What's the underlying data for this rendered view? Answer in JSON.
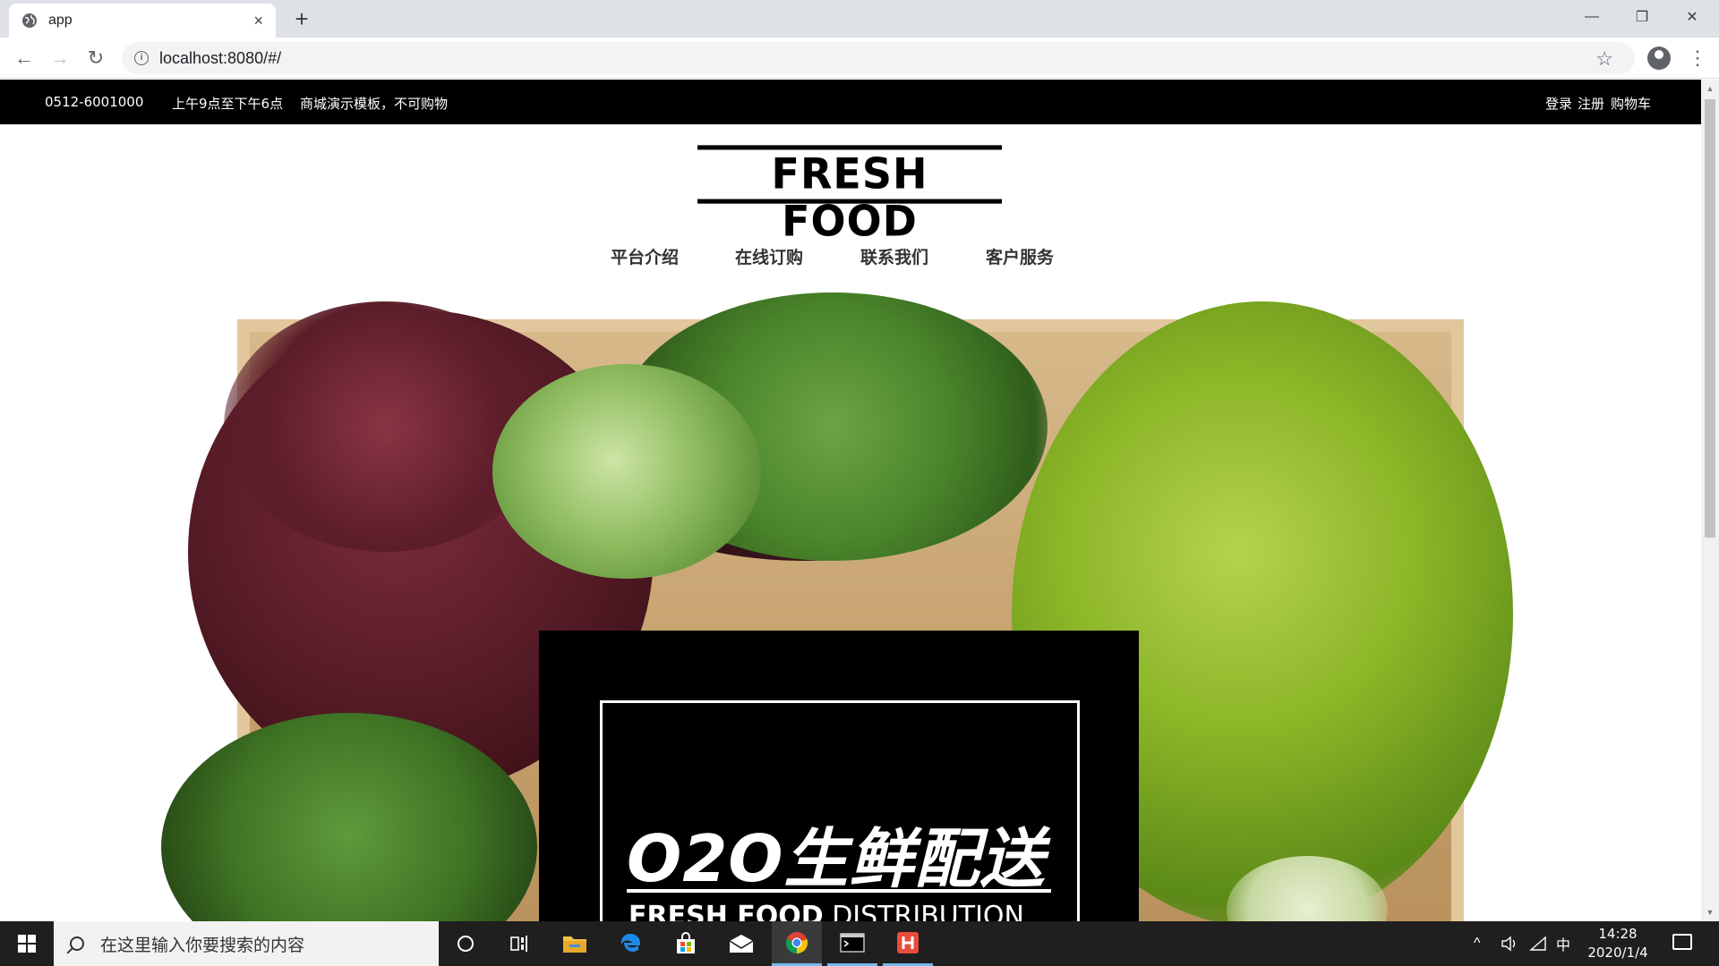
{
  "browser": {
    "tab_title": "app",
    "tab_close": "×",
    "new_tab": "+",
    "url": "localhost:8080/#/",
    "info_glyph": "i",
    "minimize": "—",
    "restore": "❐",
    "close": "✕",
    "back": "←",
    "forward": "→",
    "reload": "↻",
    "star": "☆",
    "menu": "⋮"
  },
  "topbar": {
    "phone": "0512-6001000",
    "hours": "上午9点至下午6点",
    "notice": "商城演示模板，不可购物",
    "login": "登录",
    "register": "注册",
    "cart": "购物车"
  },
  "logo": {
    "text": "FRESH FOOD"
  },
  "nav": {
    "items": [
      "平台介绍",
      "在线订购",
      "联系我们",
      "客户服务"
    ]
  },
  "hero": {
    "headline": "O2O生鲜配送",
    "subline_bold": "FRESH FOOD",
    "subline_rest": " DISTRIBUTION"
  },
  "taskbar": {
    "search_placeholder": "在这里输入你要搜索的内容",
    "time": "14:28",
    "date": "2020/1/4",
    "ime": "中",
    "tray_up": "^"
  },
  "colors": {
    "topbar_bg": "#000000",
    "taskbar_bg": "#1f1f1f",
    "browser_tabbar": "#dee1e6"
  }
}
